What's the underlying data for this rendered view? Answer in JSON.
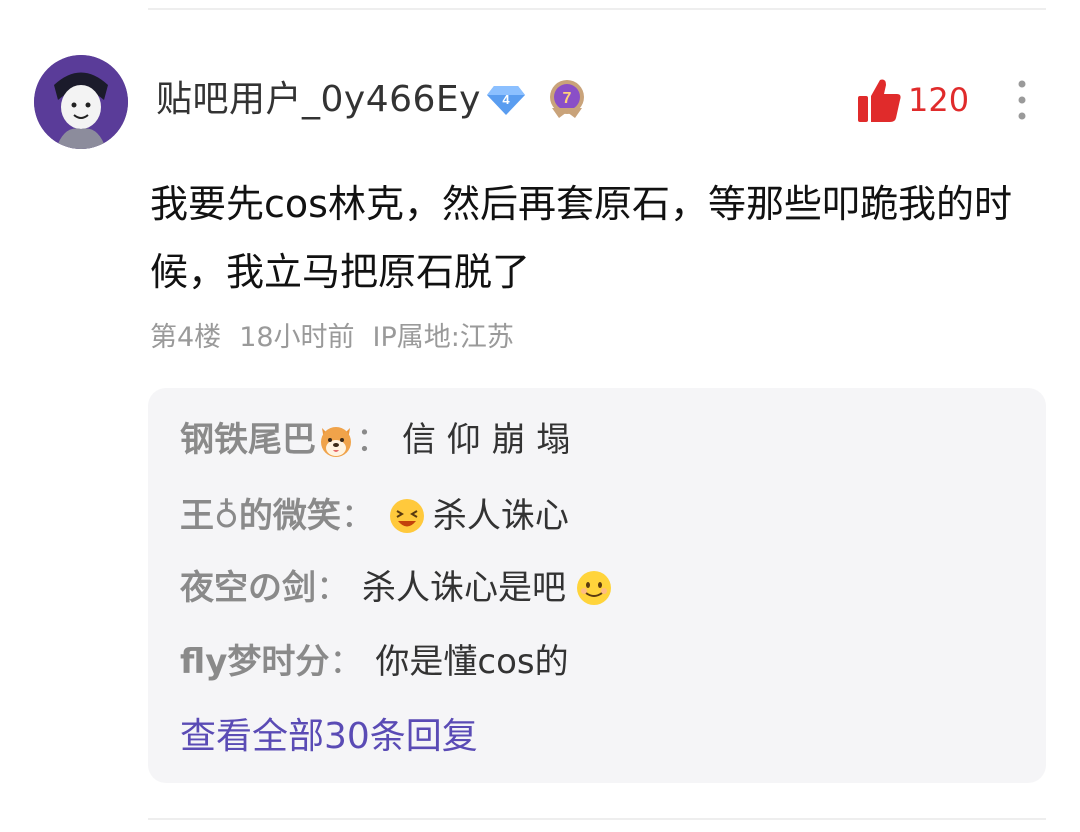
{
  "post": {
    "username": "贴吧用户_0y466Ey",
    "diamond_badge_number": "4",
    "level_badge_number": "7",
    "like_count": "120",
    "content": "我要先cos林克，然后再套原石，等那些叩跪我的时候，我立马把原石脱了",
    "meta": {
      "floor": "第4楼",
      "time": "18小时前",
      "ip": "IP属地:江苏"
    }
  },
  "replies": [
    {
      "user": "钢铁尾巴",
      "user_emoji": "shiba-dog-emoji",
      "colon": "：",
      "text": "信 仰 崩 塌",
      "text_emoji_before": "",
      "text_emoji_after": ""
    },
    {
      "user": "王♁的微笑",
      "user_emoji": "",
      "colon": "：",
      "text": "杀人诛心",
      "text_emoji_before": "laughing-emoji",
      "text_emoji_after": ""
    },
    {
      "user": "夜空の剑",
      "user_emoji": "",
      "colon": "：",
      "text": "杀人诛心是吧",
      "text_emoji_before": "",
      "text_emoji_after": "smile-emoji"
    },
    {
      "user": "fly梦时分",
      "user_emoji": "",
      "colon": "：",
      "text": "你是懂cos的",
      "text_emoji_before": "",
      "text_emoji_after": ""
    }
  ],
  "view_all_label": "查看全部30条回复",
  "colors": {
    "like_red": "#e02b2b",
    "link_purple": "#5a4bb5",
    "reply_bg": "#f5f5f7"
  },
  "icons": [
    "avatar",
    "diamond-badge-icon",
    "level-badge-icon",
    "thumbs-up-icon",
    "more-vertical-icon"
  ]
}
